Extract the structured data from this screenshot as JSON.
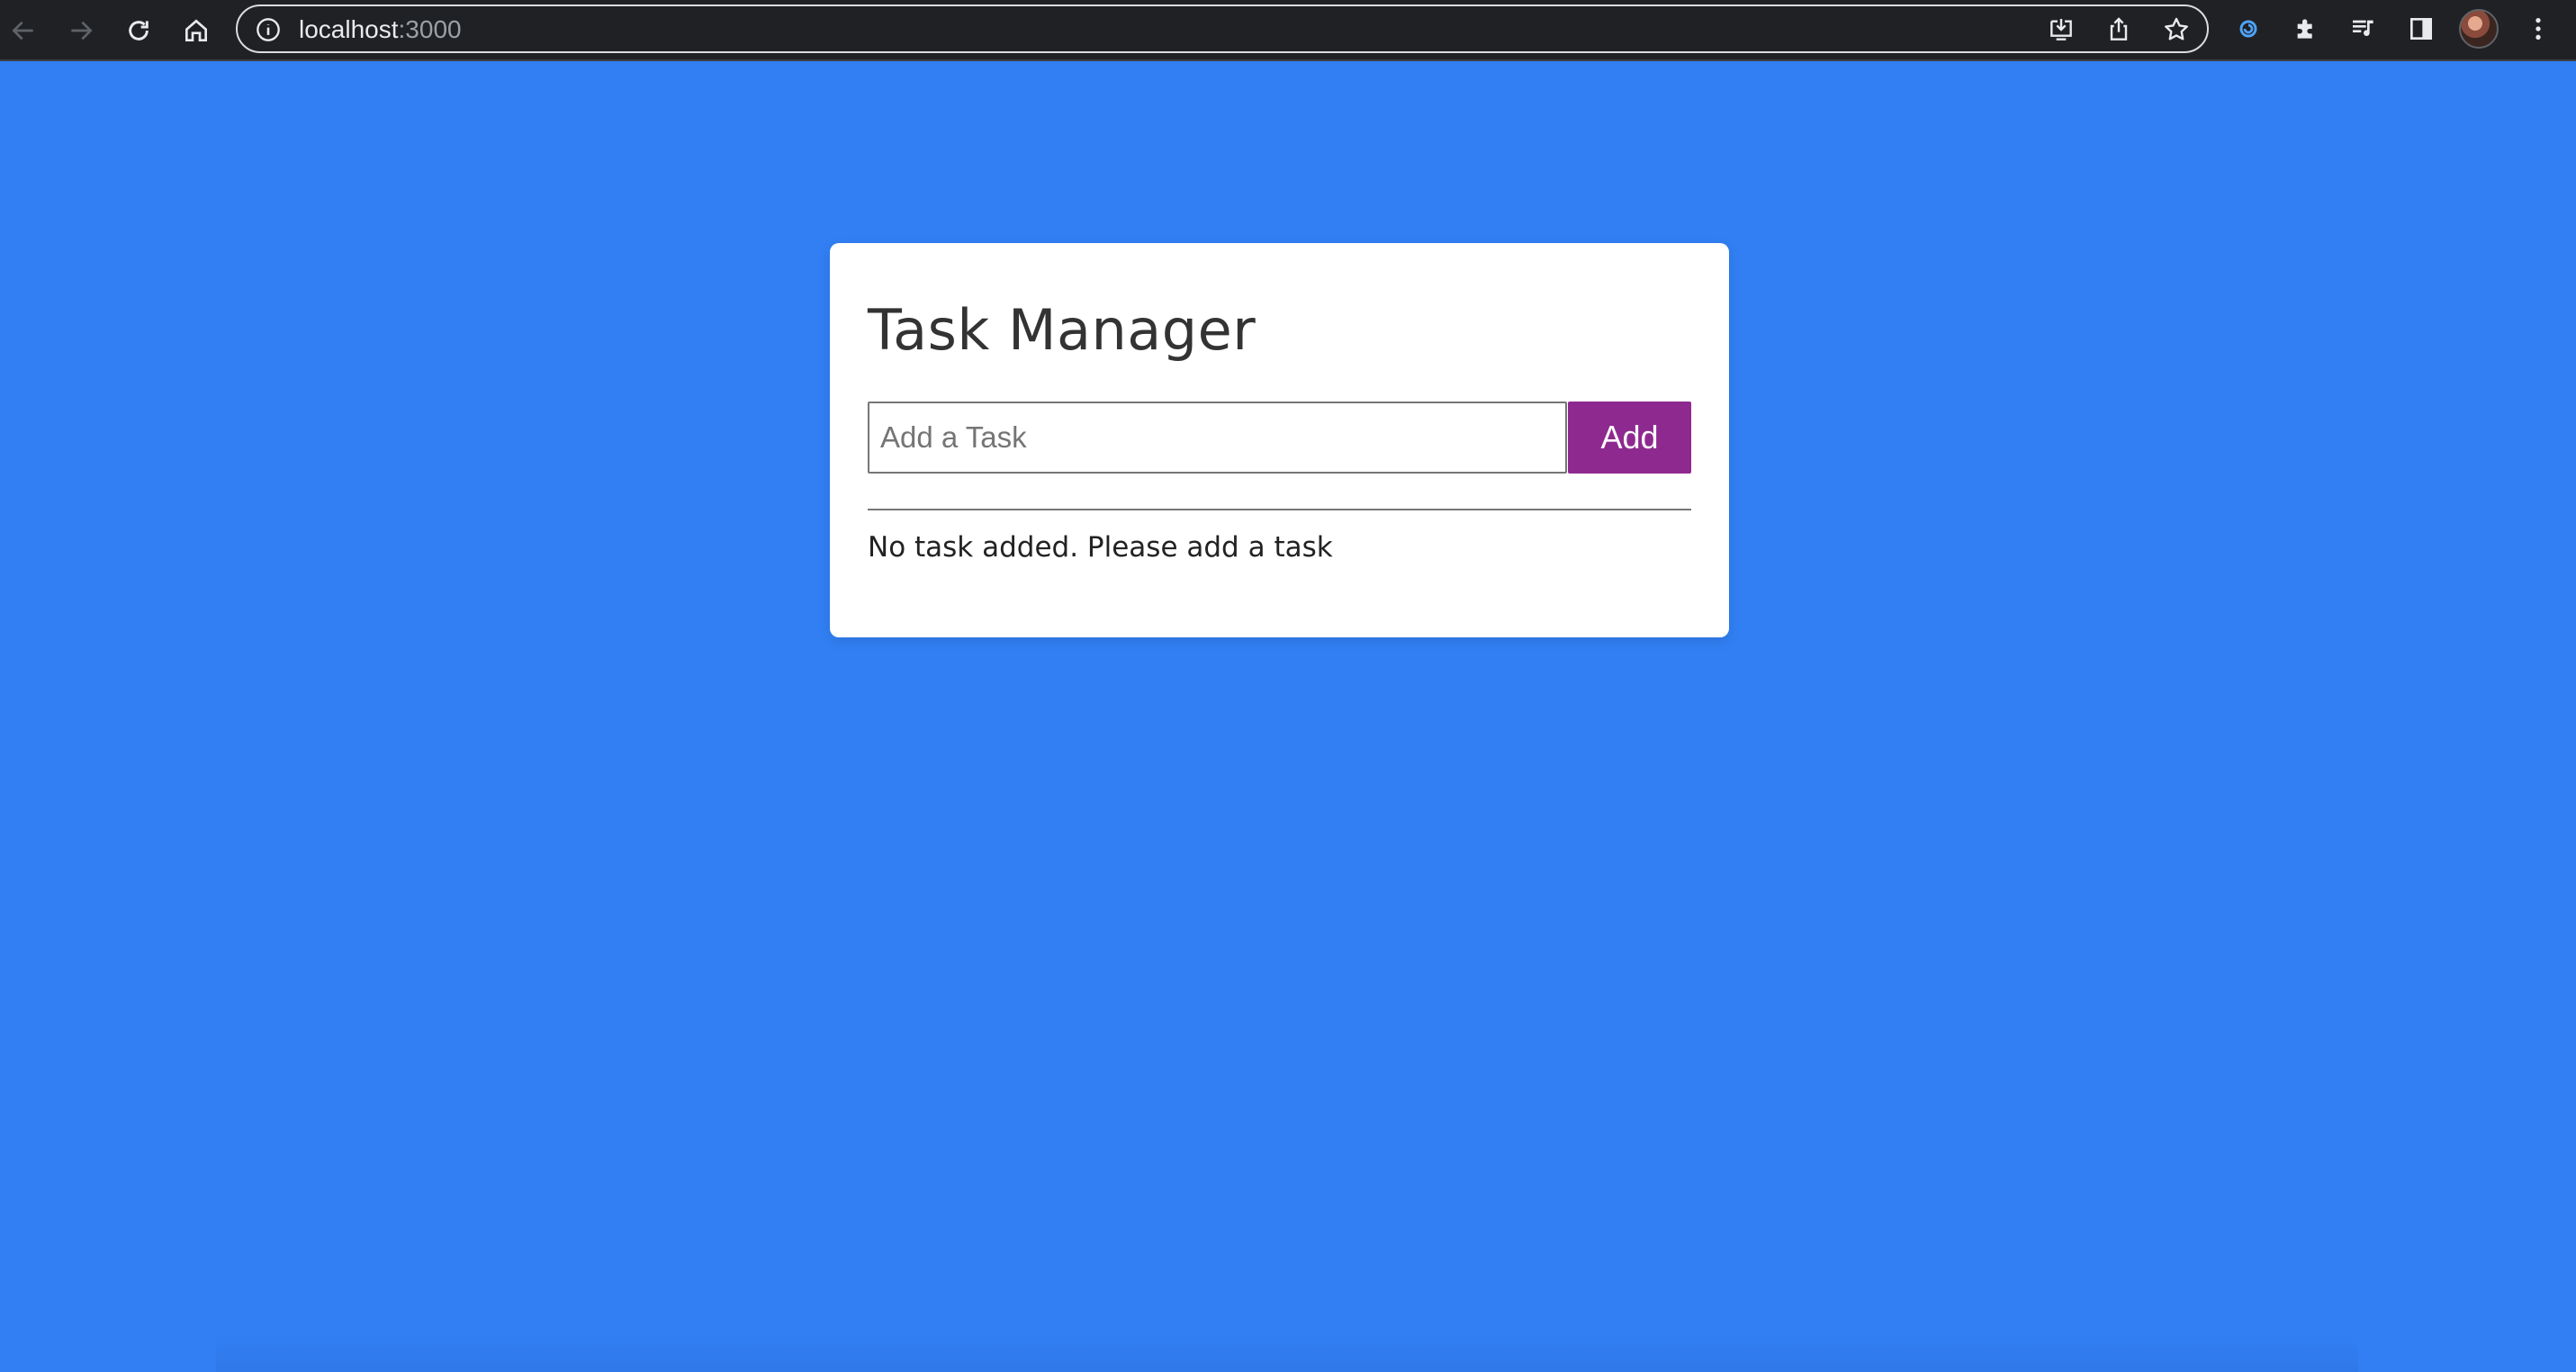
{
  "browser": {
    "url_host": "localhost",
    "url_port": ":3000",
    "icons": {
      "back": "arrow-left-icon",
      "forward": "arrow-right-icon",
      "reload": "reload-icon",
      "home": "home-icon",
      "site_info": "info-icon",
      "install": "install-app-icon",
      "share": "share-icon",
      "bookmark": "star-icon",
      "extension_1": "extension-swirl-icon",
      "extensions": "puzzle-icon",
      "media": "media-queue-icon",
      "side_panel": "side-panel-icon",
      "profile": "avatar",
      "menu": "kebab-menu-icon"
    }
  },
  "app": {
    "title": "Task Manager",
    "input_placeholder": "Add a Task",
    "input_value": "",
    "add_label": "Add",
    "empty_message": "No task added. Please add a task"
  },
  "colors": {
    "page_background": "#317ff3",
    "card_background": "#ffffff",
    "add_button": "#8e2a8f",
    "chrome_background": "#202124"
  }
}
